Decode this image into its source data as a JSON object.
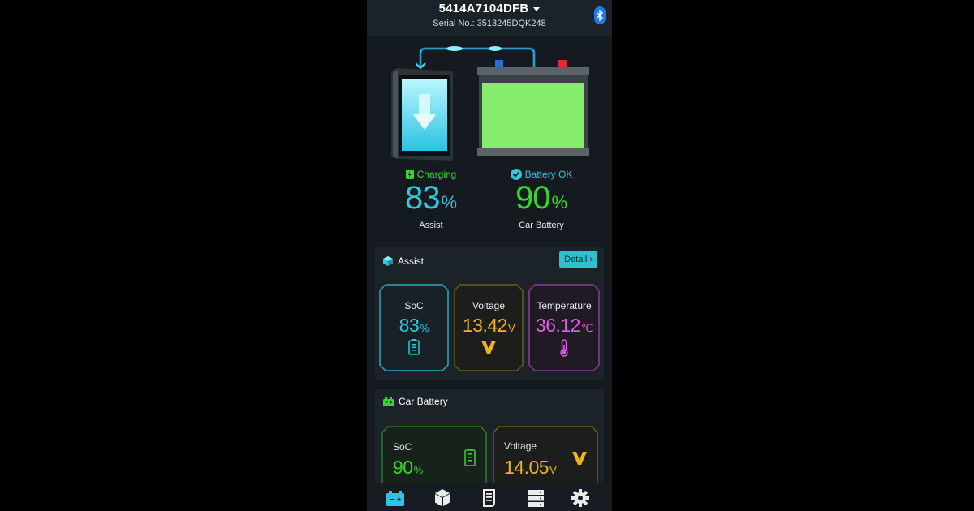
{
  "header": {
    "device_name": "5414A7104DFB",
    "serial": "Serial No.: 3513245DQK248"
  },
  "hero": {
    "assist": {
      "status": "Charging",
      "value": "83",
      "unit": "%",
      "caption": "Assist"
    },
    "car": {
      "status": "Battery OK",
      "value": "90",
      "unit": "%",
      "caption": "Car Battery"
    }
  },
  "assist_section": {
    "title": "Assist",
    "detail_label": "Detail",
    "tiles": [
      {
        "label": "SoC",
        "value": "83",
        "unit": "%",
        "icon": "battery-icon",
        "color": "#33c5db"
      },
      {
        "label": "Voltage",
        "value": "13.42",
        "unit": "V",
        "icon": "voltage-icon",
        "color": "#f2b21e"
      },
      {
        "label": "Temperature",
        "value": "36.12",
        "unit": "℃",
        "icon": "thermometer-icon",
        "color": "#e05be6"
      }
    ]
  },
  "car_section": {
    "title": "Car Battery",
    "tiles": [
      {
        "label": "SoC",
        "value": "90",
        "unit": "%",
        "icon": "battery-icon",
        "color": "#3ad42b"
      },
      {
        "label": "Voltage",
        "value": "14.05",
        "unit": "V",
        "icon": "voltage-icon",
        "color": "#f2b21e"
      }
    ]
  },
  "nav": {
    "items": [
      "battery-status-icon",
      "box-icon",
      "document-icon",
      "server-icon",
      "gear-icon"
    ],
    "active_color": "#2fc1e6"
  },
  "colors": {
    "assist": "#33c5db",
    "car": "#3ad42b",
    "voltage": "#f2b21e",
    "temperature": "#e05be6"
  }
}
